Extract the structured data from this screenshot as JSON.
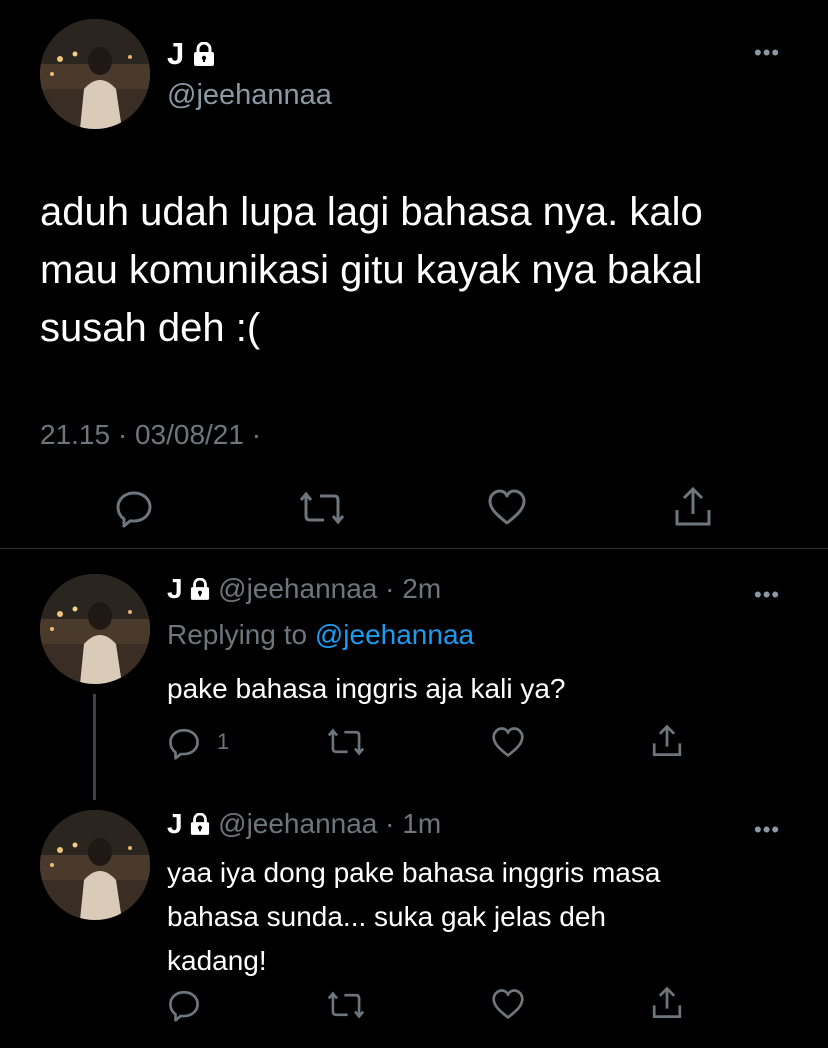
{
  "main_tweet": {
    "display_name": "J",
    "handle": "@jeehannaa",
    "text": "aduh udah lupa lagi bahasa nya. kalo mau komunikasi gitu kayak nya bakal susah deh :(",
    "timestamp": "21.15 · 03/08/21 ·",
    "icons": [
      "reply-icon",
      "retweet-icon",
      "like-icon",
      "share-icon"
    ]
  },
  "replies": [
    {
      "display_name": "J",
      "handle": "@jeehannaa",
      "time": "· 2m",
      "replying_prefix": "Replying to",
      "replying_to": "@jeehannaa",
      "text": "pake bahasa inggris aja kali ya?",
      "reply_count": "1"
    },
    {
      "display_name": "J",
      "handle": "@jeehannaa",
      "time": "· 1m",
      "text_lines": [
        "yaa iya dong pake bahasa inggris masa",
        "bahasa sunda... suka gak jelas deh",
        "kadang!"
      ]
    }
  ],
  "more_label": "•••",
  "colors": {
    "background": "#000000",
    "text": "#ffffff",
    "secondary": "#6e767d",
    "link": "#1d9bf0",
    "divider": "#2f3336"
  }
}
